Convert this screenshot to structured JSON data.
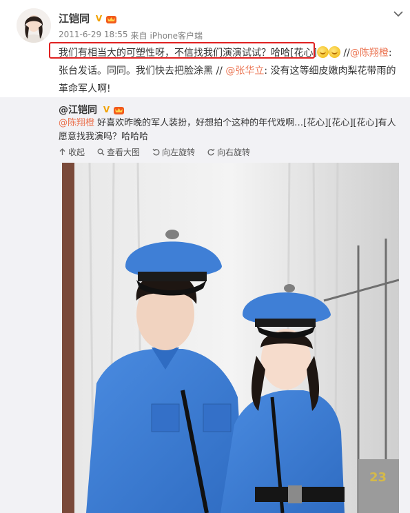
{
  "post": {
    "author": "江铠同",
    "time": "2011-6-29 18:55",
    "source_prefix": "来自",
    "source": "iPhone客户端",
    "text_highlight": "我们有相当大的可塑性呀，不信找我们演演试试？哈哈[花心]",
    "text_sep1": " //",
    "mention1": "@陈翔橙",
    "text_after1": ":张台发话。同同。我们快去把脸涂黑 // ",
    "mention2": "@张华立",
    "text_after2": ": 没有这等细皮嫩肉梨花带雨的革命军人啊!"
  },
  "repost": {
    "author": "@江铠同",
    "mention": "@陈翔橙",
    "text": " 好喜欢昨晚的军人装扮，好想拍个这种的年代戏啊…[花心][花心][花心]有人愿意找我演吗？哈哈哈",
    "actions": {
      "collapse": "收起",
      "view_large": "查看大图",
      "rotate_left": "向左旋转",
      "rotate_right": "向右旋转"
    }
  },
  "photo": {
    "number_on_wall": "23"
  },
  "colors": {
    "mention": "#eb7350",
    "highlight_box": "#e02020",
    "uniform_blue": "#3f7fd6",
    "repost_bg": "#f2f2f5"
  }
}
